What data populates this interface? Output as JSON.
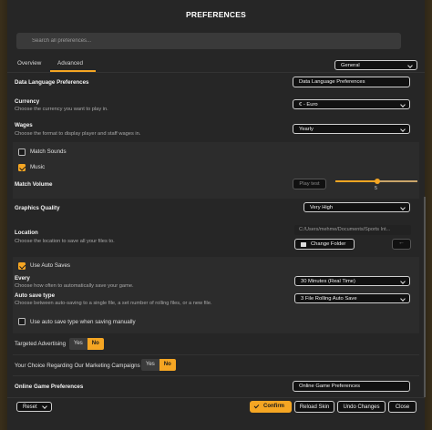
{
  "dialog": {
    "title": "PREFERENCES"
  },
  "search": {
    "placeholder": "Search all preferences..."
  },
  "tabs": [
    {
      "label": "Overview"
    },
    {
      "label": "Advanced"
    }
  ],
  "category_select": {
    "value": "General"
  },
  "data_language": {
    "label": "Data Language Preferences",
    "button": "Data Language Preferences"
  },
  "currency": {
    "label": "Currency",
    "description": "Choose the currency you want to play in.",
    "value": "€ - Euro"
  },
  "wages": {
    "label": "Wages",
    "description": "Choose the format to display player and staff wages in.",
    "value": "Yearly"
  },
  "match_sounds": {
    "label": "Match Sounds",
    "checked": false
  },
  "music": {
    "label": "Music",
    "checked": true
  },
  "match_volume": {
    "label": "Match Volume",
    "play_test": "Play test",
    "value": 5,
    "max": 10
  },
  "graphics_quality": {
    "label": "Graphics Quality",
    "value": "Very High"
  },
  "location": {
    "label": "Location",
    "description": "Choose the location to save all your files to.",
    "path": "C:/Users/mehme/Documents/Sports Int...",
    "change_folder": "Change Folder",
    "back_icon": "←"
  },
  "auto_saves": {
    "label": "Use Auto Saves",
    "checked": true
  },
  "every": {
    "label": "Every",
    "description": "Choose how often to automatically save your game.",
    "value": "30 Minutes (Real Time)"
  },
  "auto_save_type": {
    "label": "Auto save type",
    "description": "Choose between auto-saving to a single file, a set number of rolling files, or a new file.",
    "value": "3 File Rolling Auto Save"
  },
  "auto_save_manual": {
    "label": "Use auto save type when saving manually",
    "checked": false
  },
  "targeted_advertising": {
    "label": "Targeted Advertising",
    "yes": "Yes",
    "no": "No",
    "selected": "No"
  },
  "marketing": {
    "label": "Your Choice Regarding Our Marketing Campaigns",
    "yes": "Yes",
    "no": "No",
    "selected": "No"
  },
  "online_game": {
    "label": "Online Game Preferences",
    "button": "Online Game Preferences"
  },
  "footer": {
    "reset": "Reset",
    "confirm": "Confirm",
    "reload_skin": "Reload Skin",
    "undo_changes": "Undo Changes",
    "close": "Close"
  },
  "colors": {
    "accent": "#f5a623",
    "background": "#262626"
  },
  "icons": {
    "search": "search-icon",
    "folder": "folder-icon",
    "check": "check-icon",
    "chevron": "chevron-down-icon"
  }
}
